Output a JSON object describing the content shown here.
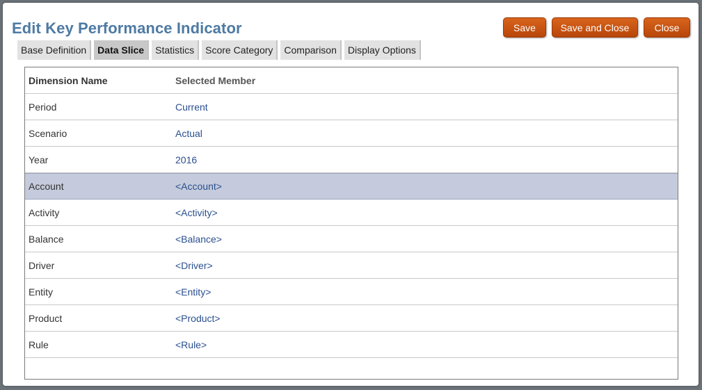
{
  "dialog": {
    "title": "Edit Key Performance Indicator",
    "buttons": {
      "save": "Save",
      "save_close": "Save and Close",
      "close": "Close"
    }
  },
  "tabs": [
    {
      "label": "Base Definition",
      "active": false
    },
    {
      "label": "Data Slice",
      "active": true
    },
    {
      "label": "Statistics",
      "active": false
    },
    {
      "label": "Score Category",
      "active": false
    },
    {
      "label": "Comparison",
      "active": false
    },
    {
      "label": "Display Options",
      "active": false
    }
  ],
  "table": {
    "headers": {
      "dimension": "Dimension Name",
      "member": "Selected Member"
    },
    "rows": [
      {
        "dimension": "Period",
        "member": "Current"
      },
      {
        "dimension": "Scenario",
        "member": "Actual"
      },
      {
        "dimension": "Year",
        "member": "2016"
      },
      {
        "dimension": "Account",
        "member": "<Account>"
      },
      {
        "dimension": "Activity",
        "member": "<Activity>"
      },
      {
        "dimension": "Balance",
        "member": "<Balance>"
      },
      {
        "dimension": "Driver",
        "member": "<Driver>"
      },
      {
        "dimension": "Entity",
        "member": "<Entity>"
      },
      {
        "dimension": "Product",
        "member": "<Product>"
      },
      {
        "dimension": "Rule",
        "member": "<Rule>"
      }
    ],
    "selected_row": "Account"
  },
  "colors": {
    "title": "#4d7aa3",
    "button": "#c4520f",
    "selected_row": "#c5cbdc",
    "member_link": "#2a4f8f"
  }
}
